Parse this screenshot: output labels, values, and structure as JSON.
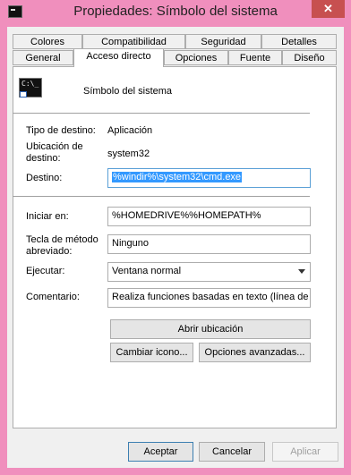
{
  "window": {
    "title": "Propiedades: Símbolo del sistema",
    "close_label": "✕"
  },
  "tabs": {
    "row1": [
      "Colores",
      "Compatibilidad",
      "Seguridad",
      "Detalles"
    ],
    "row2": [
      "General",
      "Acceso directo",
      "Opciones",
      "Fuente",
      "Diseño"
    ],
    "active": "Acceso directo"
  },
  "shortcut": {
    "icon_text": "C:\\_",
    "name": "Símbolo del sistema",
    "target_type_label": "Tipo de destino:",
    "target_type": "Aplicación",
    "target_location_label": "Ubicación de destino:",
    "target_location": "system32",
    "target_label": "Destino:",
    "target": "%windir%\\system32\\cmd.exe",
    "start_in_label": "Iniciar en:",
    "start_in": "%HOMEDRIVE%%HOMEPATH%",
    "hotkey_label": "Tecla de método abreviado:",
    "hotkey": "Ninguno",
    "run_label": "Ejecutar:",
    "run": "Ventana normal",
    "comment_label": "Comentario:",
    "comment": "Realiza funciones basadas en texto (línea de c"
  },
  "buttons": {
    "open_location": "Abrir ubicación",
    "change_icon": "Cambiar icono...",
    "advanced": "Opciones avanzadas...",
    "ok": "Aceptar",
    "cancel": "Cancelar",
    "apply": "Aplicar"
  }
}
